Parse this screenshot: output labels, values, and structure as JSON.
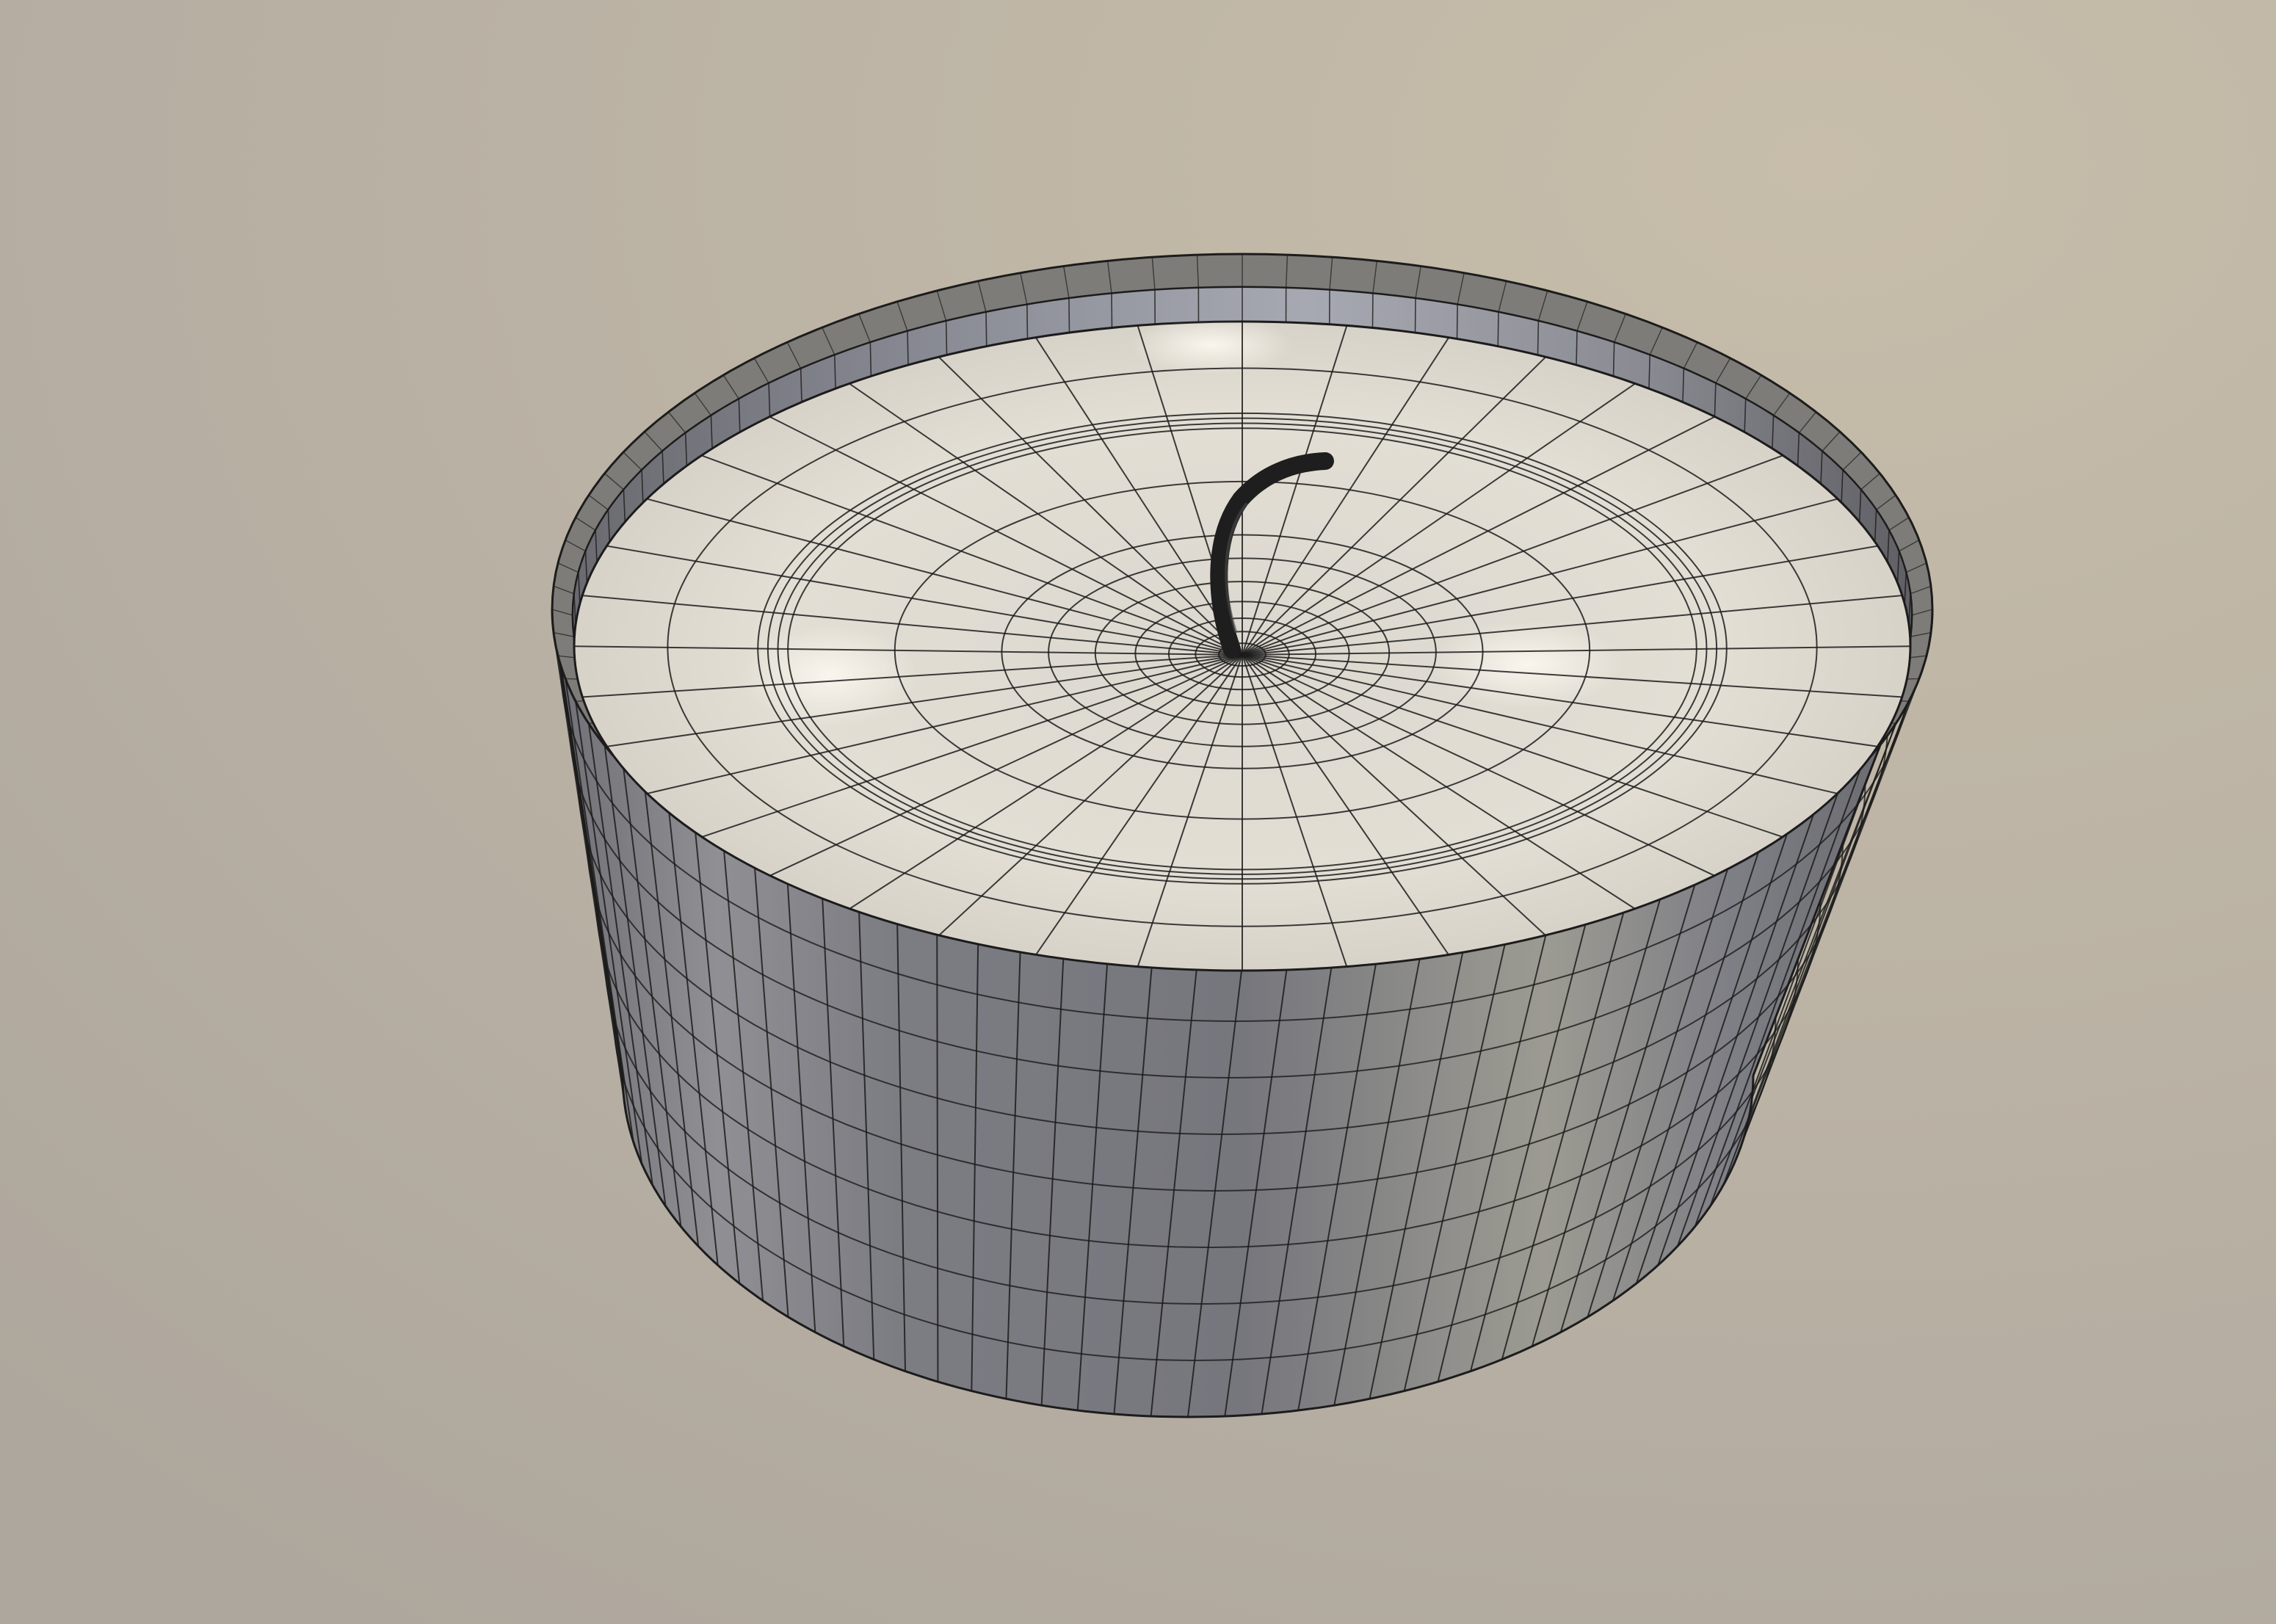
{
  "scene": {
    "subject": "tealight-candle-wireframe",
    "background_color": "#b6aea1",
    "background_light_color": "#c4b9a7",
    "cup_color": "#84848a",
    "cup_highlight_color": "#a4a39e",
    "cup_inner_wall_color": "#8d8f98",
    "wax_color": "#e0dcd2",
    "wax_highlight_color": "#f3efe6",
    "wick_color": "#1e1e1e",
    "wire_color": "#1c1c1c",
    "wax_radial_segments": 40,
    "wax_ring_count": 14,
    "cup_side_segments": 96,
    "cup_side_rows": 8,
    "rim_segments": 96
  }
}
